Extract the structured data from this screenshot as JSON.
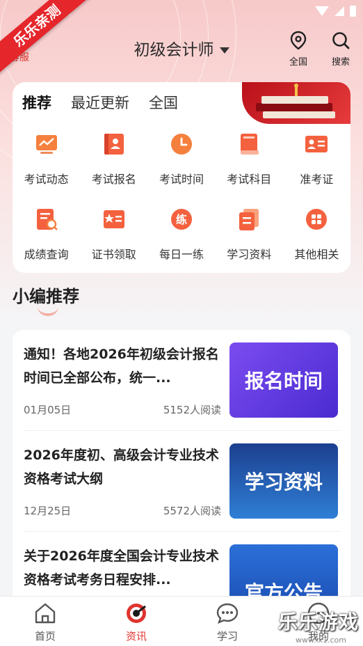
{
  "header": {
    "title": "初级会计师",
    "service_label": "客服",
    "region_label": "全国",
    "search_label": "搜索"
  },
  "watermark_ribbon": "乐乐亲测",
  "tabs": [
    {
      "label": "推荐"
    },
    {
      "label": "最近更新"
    },
    {
      "label": "全国"
    }
  ],
  "grid": [
    {
      "label": "考试动态",
      "icon": "chart-icon"
    },
    {
      "label": "考试报名",
      "icon": "registration-icon"
    },
    {
      "label": "考试时间",
      "icon": "clock-icon"
    },
    {
      "label": "考试科目",
      "icon": "book-icon"
    },
    {
      "label": "准考证",
      "icon": "id-card-icon"
    },
    {
      "label": "成绩查询",
      "icon": "score-search-icon"
    },
    {
      "label": "证书领取",
      "icon": "certificate-icon"
    },
    {
      "label": "每日一练",
      "icon": "practice-icon",
      "glyph": "练"
    },
    {
      "label": "学习资料",
      "icon": "study-material-icon"
    },
    {
      "label": "其他相关",
      "icon": "apps-icon"
    }
  ],
  "section_title": "小编推荐",
  "articles": [
    {
      "title": "通知！各地2026年初级会计报名时间已全部公布，统一...",
      "date": "01月05日",
      "reads": "5152人阅读",
      "thumb_text": "报名时间"
    },
    {
      "title": "2026年度初、高级会计专业技术资格考试大纲",
      "date": "12月25日",
      "reads": "5572人阅读",
      "thumb_text": "学习资料"
    },
    {
      "title": "关于2026年度全国会计专业技术资格考试考务日程安排...",
      "date": "",
      "reads": "",
      "thumb_text": "官方公告"
    }
  ],
  "bottom_nav": [
    {
      "label": "首页"
    },
    {
      "label": "资讯"
    },
    {
      "label": "学习"
    },
    {
      "label": "我的"
    }
  ],
  "watermark": {
    "text": "乐乐游戏",
    "sub": "www.lx1.com"
  },
  "colors": {
    "accent": "#e0342e",
    "card_purple": "#6c3de8",
    "card_blue": "#1f4fb8"
  }
}
